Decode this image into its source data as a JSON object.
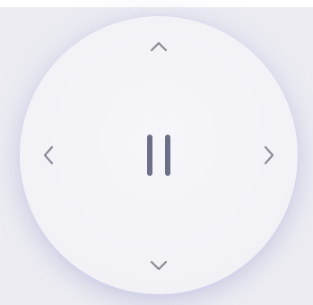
{
  "dpad": {
    "up": {
      "icon": "chevron-up-icon"
    },
    "down": {
      "icon": "chevron-down-icon"
    },
    "left": {
      "icon": "chevron-left-icon"
    },
    "right": {
      "icon": "chevron-right-icon"
    },
    "center": {
      "icon": "pause-icon"
    }
  },
  "colors": {
    "background": "#ececf2",
    "pad_surface": "#f2f2f7",
    "chevron": "#8a8a96",
    "pause": "#6c6f88"
  }
}
